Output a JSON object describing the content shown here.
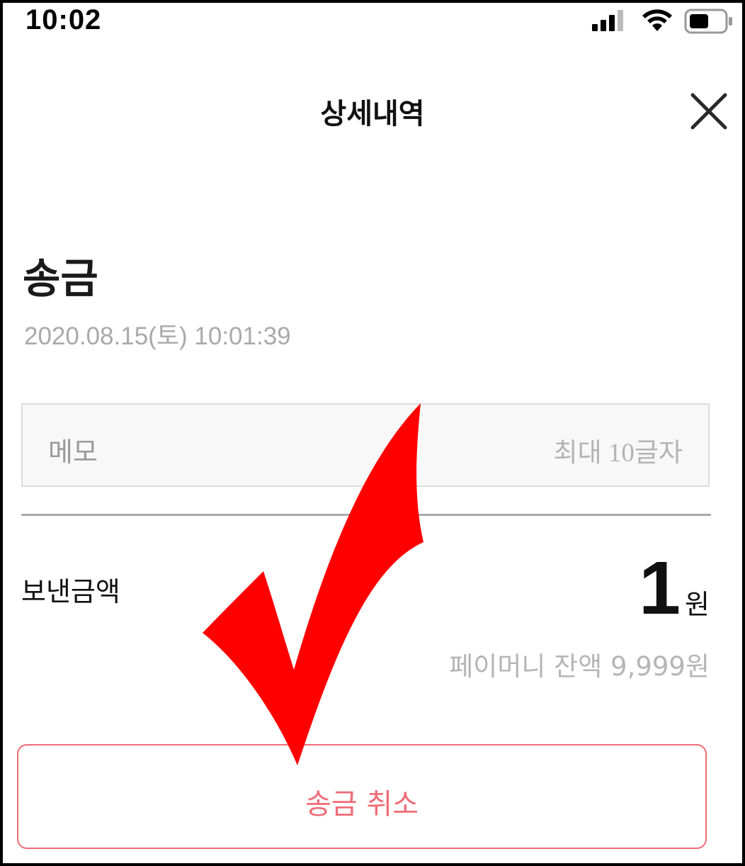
{
  "status_bar": {
    "time": "10:02",
    "icons": [
      "signal-icon",
      "wifi-icon",
      "battery-icon"
    ]
  },
  "header": {
    "title": "상세내역",
    "close_icon": "close-icon"
  },
  "transaction": {
    "type": "송금",
    "datetime": "2020.08.15(토) 10:01:39"
  },
  "memo": {
    "label": "메모",
    "limit": "최대 10글자"
  },
  "amount": {
    "label": "보낸금액",
    "value": "1",
    "unit": "원",
    "balance": "페이머니 잔액 9,999원"
  },
  "cancel_button": {
    "label": "송금 취소",
    "color": "#ee6c76"
  },
  "annotation": {
    "icon": "red-checkmark-icon",
    "color": "#ff0000"
  }
}
